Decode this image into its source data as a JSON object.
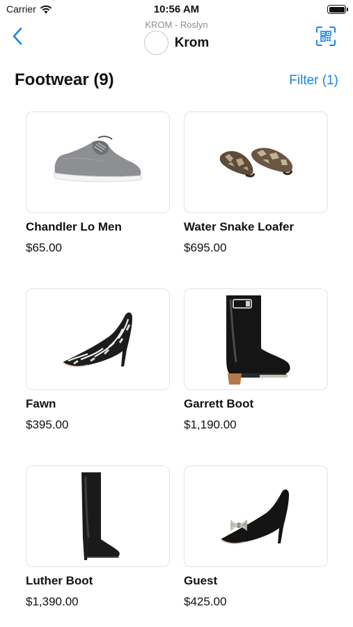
{
  "status_bar": {
    "carrier": "Carrier",
    "time": "10:56 AM"
  },
  "nav": {
    "subtitle": "KROM - Roslyn",
    "title": "Krom",
    "back_icon": "chevron-left-icon",
    "scan_icon": "qr-scan-icon"
  },
  "section": {
    "title": "Footwear (9)",
    "filter_label": "Filter (1)"
  },
  "colors": {
    "accent": "#1a82e8",
    "text": "#111111",
    "secondary_text": "#8e8e93",
    "card_border": "#e3e3e6"
  },
  "products": [
    {
      "name": "Chandler Lo Men",
      "price": "$65.00",
      "image_icon": "gray-sneaker-image"
    },
    {
      "name": "Water Snake Loafer",
      "price": "$695.00",
      "image_icon": "snakeskin-loafer-image"
    },
    {
      "name": "Fawn",
      "price": "$395.00",
      "image_icon": "printed-pump-image"
    },
    {
      "name": "Garrett Boot",
      "price": "$1,190.00",
      "image_icon": "black-ankle-boot-image"
    },
    {
      "name": "Luther Boot",
      "price": "$1,390.00",
      "image_icon": "tall-black-boot-image"
    },
    {
      "name": "Guest",
      "price": "$425.00",
      "image_icon": "black-bow-pump-image"
    }
  ]
}
